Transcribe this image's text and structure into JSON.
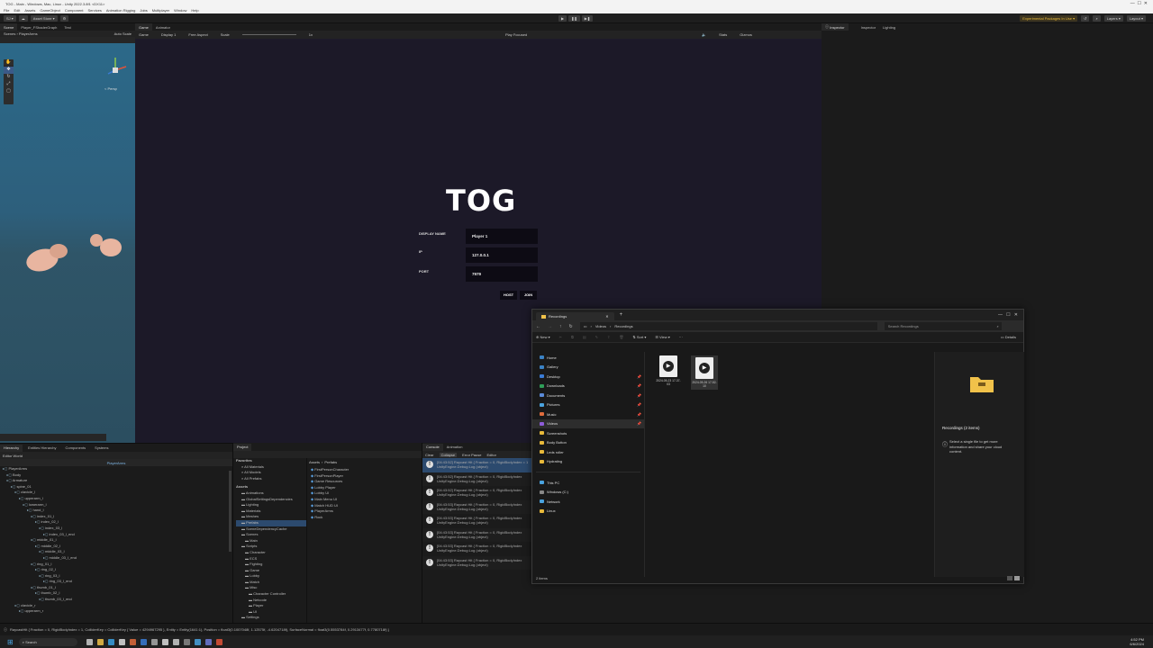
{
  "window": {
    "title": "TOG - Main - Windows, Mac, Linux - Unity 2022.3.8f1 <DX11>",
    "menu": [
      "File",
      "Edit",
      "Assets",
      "GameObject",
      "Component",
      "Services",
      "Animation Rigging",
      "Jobs",
      "Multiplayer",
      "Window",
      "Help"
    ]
  },
  "toolbar": {
    "account": "SJ",
    "asset_store": "Asset Store",
    "experimental": "Experimental Packages In Use",
    "layers": "Layers",
    "layout": "Layout"
  },
  "scene_panel": {
    "tabs": [
      "Scene",
      "Player_FShaderGraph",
      "Test"
    ],
    "breadcrumb": "PlayerArms",
    "persp": "< Persp",
    "auto_scale": "Auto Scale"
  },
  "game_panel": {
    "tabs": [
      "Game",
      "Animator"
    ],
    "display": "Game",
    "display_num": "Display 1",
    "aspect": "Free Aspect",
    "scale_label": "Scale",
    "scale_val": "1x",
    "play_focused": "Play Focused",
    "stats": "Stats",
    "gizmos": "Gizmos",
    "ui": {
      "title": "TOG",
      "display_name_label": "DISPLAY NAME",
      "display_name_value": "Player 1",
      "ip_label": "IP",
      "ip_value": "127.0.0.1",
      "port_label": "PORT",
      "port_value": "7979",
      "host_label": "HOST",
      "join_label": "JOIN"
    }
  },
  "inspector": {
    "tabs": [
      "Inspector",
      "Inspector",
      "Lighting"
    ]
  },
  "hierarchy": {
    "tabs": [
      "Hierarchy",
      "Entities Hierarchy",
      "Components",
      "Systems"
    ],
    "world": "Editor World",
    "header": "PlayerArms",
    "items": [
      {
        "t": "PlayerArms",
        "d": 0
      },
      {
        "t": "Body",
        "d": 1
      },
      {
        "t": "Armature",
        "d": 1
      },
      {
        "t": "spine_01",
        "d": 2
      },
      {
        "t": "clavicle_l",
        "d": 3
      },
      {
        "t": "upperarm_l",
        "d": 4
      },
      {
        "t": "lowerarm_l",
        "d": 5
      },
      {
        "t": "hand_l",
        "d": 6
      },
      {
        "t": "index_01_l",
        "d": 7
      },
      {
        "t": "index_02_l",
        "d": 8
      },
      {
        "t": "index_03_l",
        "d": 9
      },
      {
        "t": "index_03_l_end",
        "d": 10
      },
      {
        "t": "middle_01_l",
        "d": 7
      },
      {
        "t": "middle_02_l",
        "d": 8
      },
      {
        "t": "middle_03_l",
        "d": 9
      },
      {
        "t": "middle_03_l_end",
        "d": 10
      },
      {
        "t": "ring_01_l",
        "d": 7
      },
      {
        "t": "ring_02_l",
        "d": 8
      },
      {
        "t": "ring_03_l",
        "d": 9
      },
      {
        "t": "ring_03_l_end",
        "d": 10
      },
      {
        "t": "thumb_01_l",
        "d": 7
      },
      {
        "t": "thumb_02_l",
        "d": 8
      },
      {
        "t": "thumb_03_l_end",
        "d": 9
      },
      {
        "t": "clavicle_r",
        "d": 3
      },
      {
        "t": "upperarm_r",
        "d": 4
      }
    ]
  },
  "project": {
    "tabs": [
      "Project"
    ],
    "favorites_label": "Favorites",
    "favorites": [
      "All Materials",
      "All Models",
      "All Prefabs"
    ],
    "assets_label": "Assets",
    "folders": [
      "Animations",
      "GlobalSettingsDependencies",
      "Lighting",
      "Materials",
      "Meshes",
      "Prefabs",
      "SceneDependencyCache",
      "Scenes",
      "Main",
      "Scripts",
      "Character",
      "ECS",
      "Fighting",
      "Game",
      "Lobby",
      "Match",
      "Misc",
      "Character Controller",
      "Netcode",
      "Player",
      "UI",
      "Settings"
    ],
    "path": [
      "Assets",
      "Prefabs"
    ],
    "prefabs": [
      "FirstPersonCharacter",
      "FirstPersonPlayer",
      "Game Resources",
      "Lobby Player",
      "Lobby UI",
      "Main Menu UI",
      "Match HUD UI",
      "PlayerArms",
      "Rock"
    ]
  },
  "console": {
    "tabs": [
      "Console",
      "Animation"
    ],
    "clear": "Clear",
    "collapse": "Collapse",
    "error_pause": "Error Pause",
    "editor": "Editor",
    "logs": [
      {
        "time": "[04:43:52]",
        "msg": "Raycast Hit { Fraction = 0, RigidBodyIndex = 1",
        "sub": "UnityEngine.Debug:Log (object)"
      },
      {
        "time": "[04:43:52]",
        "msg": "Raycast Hit { Fraction = 0, RigidBodyIndex",
        "sub": "UnityEngine.Debug:Log (object)"
      },
      {
        "time": "[04:43:52]",
        "msg": "Raycast Hit { Fraction = 0, RigidBodyIndex",
        "sub": "UnityEngine.Debug:Log (object)"
      },
      {
        "time": "[04:43:53]",
        "msg": "Raycast Hit { Fraction = 0, RigidBodyIndex",
        "sub": "UnityEngine.Debug:Log (object)"
      },
      {
        "time": "[04:43:53]",
        "msg": "Raycast Hit { Fraction = 0, RigidBodyIndex",
        "sub": "UnityEngine.Debug:Log (object)"
      },
      {
        "time": "[04:43:53]",
        "msg": "Raycast Hit { Fraction = 0, RigidBodyIndex",
        "sub": "UnityEngine.Debug:Log (object)"
      },
      {
        "time": "[04:43:53]",
        "msg": "Raycast Hit { Fraction = 0, RigidBodyIndex",
        "sub": "UnityEngine.Debug:Log (object)"
      },
      {
        "time": "[04:43:53]",
        "msg": "Raycast Hit { Fraction = 0, RigidBodyIndex",
        "sub": "UnityEngine.Debug:Log (object)"
      }
    ]
  },
  "statusbar": {
    "text": "RaycastHit { Fraction = 0, RigidBodyIndex = 1, ColliderKey = ColliderKey { Value = 4294967295 }, Entity = Entity(1641:1), Position = float3(0.1007048f, 1.12575f, -4.6204718f), SurfaceNormal = float3(0.5553784f, 0.2913477f, 0.7780718f) }"
  },
  "explorer": {
    "title": "Recordings",
    "path": [
      "Videos",
      "Recordings"
    ],
    "search_placeholder": "Search Recordings",
    "new_label": "New",
    "sort_label": "Sort",
    "view_label": "View",
    "details_label": "Details",
    "nav": [
      {
        "label": "Home",
        "color": "#3b82c4"
      },
      {
        "label": "Gallery",
        "color": "#3b82c4"
      },
      {
        "label": "Desktop",
        "color": "#3a7bd5",
        "pin": true
      },
      {
        "label": "Downloads",
        "color": "#2f9e58",
        "pin": true
      },
      {
        "label": "Documents",
        "color": "#5b8bd9",
        "pin": true
      },
      {
        "label": "Pictures",
        "color": "#4aa3df",
        "pin": true
      },
      {
        "label": "Music",
        "color": "#e06c3c",
        "pin": true
      },
      {
        "label": "Videos",
        "color": "#8e5cd9",
        "pin": true
      },
      {
        "label": "Screenshots",
        "color": "#e8b93a"
      },
      {
        "label": "Body Button",
        "color": "#e8b93a"
      },
      {
        "label": "Leds roller",
        "color": "#e8b93a"
      },
      {
        "label": "Hydrating",
        "color": "#e8b93a"
      }
    ],
    "nav2": [
      {
        "label": "This PC",
        "color": "#4aa3df"
      },
      {
        "label": "Windows (C:)",
        "color": "#888"
      },
      {
        "label": "Network",
        "color": "#4aa3df"
      },
      {
        "label": "Linux",
        "color": "#e8b93a"
      }
    ],
    "files": [
      {
        "name": "2024-05-23 17-37-03"
      },
      {
        "name": "2024-05-26 17-52-10"
      }
    ],
    "details_title": "Recordings (2 items)",
    "details_text": "Select a single file to get more information and share your cloud content.",
    "status": "2 items",
    "colors": {
      "folder": "#f1c24a"
    }
  },
  "taskbar": {
    "search": "Search",
    "time": "4:52 PM",
    "date": "6/6/2024"
  }
}
